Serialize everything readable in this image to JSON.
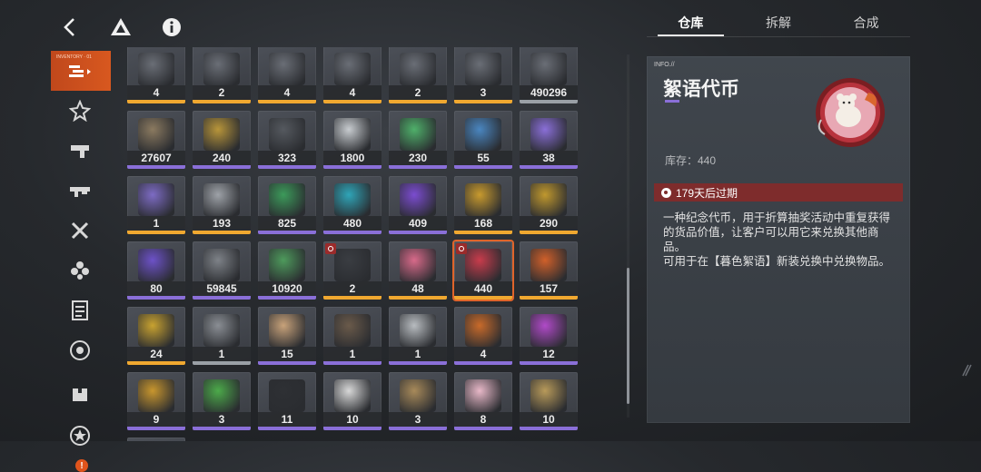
{
  "tabs": [
    "仓库",
    "拆解",
    "合成"
  ],
  "sidebar": {
    "active_tag": "INVENTORY · 01"
  },
  "grid": {
    "rows": [
      [
        {
          "count": "4",
          "rarity": "#f0a830",
          "art": "#6a6e76"
        },
        {
          "count": "2",
          "rarity": "#f0a830",
          "art": "#6a6e76"
        },
        {
          "count": "4",
          "rarity": "#f0a830",
          "art": "#6a6e76"
        },
        {
          "count": "4",
          "rarity": "#f0a830",
          "art": "#6a6e76"
        },
        {
          "count": "2",
          "rarity": "#f0a830",
          "art": "#6a6e76"
        },
        {
          "count": "3",
          "rarity": "#f0a830",
          "art": "#6a6e76"
        },
        {
          "count": "490296",
          "rarity": "#9aa0a6",
          "art": "#6a6e76"
        }
      ],
      [
        {
          "count": "27607",
          "rarity": "#8a6fd8",
          "art": "#8b7a60"
        },
        {
          "count": "240",
          "rarity": "#8a6fd8",
          "art": "#b8953a"
        },
        {
          "count": "323",
          "rarity": "#8a6fd8",
          "art": "#55595f"
        },
        {
          "count": "1800",
          "rarity": "#8a6fd8",
          "art": "#c8ccd0"
        },
        {
          "count": "230",
          "rarity": "#8a6fd8",
          "art": "#4fb06a"
        },
        {
          "count": "55",
          "rarity": "#8a6fd8",
          "art": "#4a86c0"
        },
        {
          "count": "38",
          "rarity": "#8a6fd8",
          "art": "#8a6fd8"
        }
      ],
      [
        {
          "count": "1",
          "rarity": "#f0a830",
          "art": "#7d6bc4"
        },
        {
          "count": "193",
          "rarity": "#f0a830",
          "art": "#9ea2a8"
        },
        {
          "count": "825",
          "rarity": "#8a6fd8",
          "art": "#3c9a5a"
        },
        {
          "count": "480",
          "rarity": "#8a6fd8",
          "art": "#2fa5b8"
        },
        {
          "count": "409",
          "rarity": "#8a6fd8",
          "art": "#7b4cd0"
        },
        {
          "count": "168",
          "rarity": "#f0a830",
          "art": "#c89a2e"
        },
        {
          "count": "290",
          "rarity": "#f0a830",
          "art": "#c0982e"
        }
      ],
      [
        {
          "count": "80",
          "rarity": "#8a6fd8",
          "art": "#6d52c8"
        },
        {
          "count": "59845",
          "rarity": "#8a6fd8",
          "art": "#7e8288"
        },
        {
          "count": "10920",
          "rarity": "#8a6fd8",
          "art": "#4e9a5c"
        },
        {
          "count": "2",
          "rarity": "#f0a830",
          "art": "#3a3d42",
          "timer": true
        },
        {
          "count": "48",
          "rarity": "#f0a830",
          "art": "#d86a8a"
        },
        {
          "count": "440",
          "rarity": "#f0a830",
          "art": "#c83c4c",
          "timer": true,
          "selected": true
        },
        {
          "count": "157",
          "rarity": "#f0a830",
          "art": "#d0602a"
        }
      ],
      [
        {
          "count": "24",
          "rarity": "#f0a830",
          "art": "#c8a230"
        },
        {
          "count": "1",
          "rarity": "#9aa0a6",
          "art": "#8a8e94"
        },
        {
          "count": "15",
          "rarity": "#8a6fd8",
          "art": "#c8a27a"
        },
        {
          "count": "1",
          "rarity": "#8a6fd8",
          "art": "#6a5a4a"
        },
        {
          "count": "1",
          "rarity": "#8a6fd8",
          "art": "#b8bcc0"
        },
        {
          "count": "4",
          "rarity": "#8a6fd8",
          "art": "#c86a2a"
        },
        {
          "count": "12",
          "rarity": "#8a6fd8",
          "art": "#b04ac8"
        }
      ],
      [
        {
          "count": "9",
          "rarity": "#8a6fd8",
          "art": "#c8962e"
        },
        {
          "count": "3",
          "rarity": "#8a6fd8",
          "art": "#4caa4a"
        },
        {
          "count": "11",
          "rarity": "#8a6fd8",
          "art": "#2e3034"
        },
        {
          "count": "10",
          "rarity": "#8a6fd8",
          "art": "#d8d8d8"
        },
        {
          "count": "3",
          "rarity": "#8a6fd8",
          "art": "#a88a5a"
        },
        {
          "count": "8",
          "rarity": "#8a6fd8",
          "art": "#e8b8c8"
        },
        {
          "count": "10",
          "rarity": "#8a6fd8",
          "art": "#b89a5a"
        }
      ],
      [
        {
          "count": "",
          "rarity": "#8a6fd8",
          "art": "#6a6e74"
        }
      ]
    ]
  },
  "detail": {
    "info_tag": "INFO.//",
    "name": "絮语代币",
    "stock": "库存：440",
    "expire": "179天后过期",
    "description": [
      "一种纪念代币，用于折算抽奖活动中重复获得的货品价值，让客户可以用它来兑换其他商品。",
      "可用于在【暮色絮语】新装兑换中兑换物品。"
    ]
  },
  "colors": {
    "accent_orange": "#d8581f",
    "expire_red": "#7e2c2c",
    "rarity_gold": "#f0a830",
    "rarity_purple": "#8a6fd8"
  }
}
